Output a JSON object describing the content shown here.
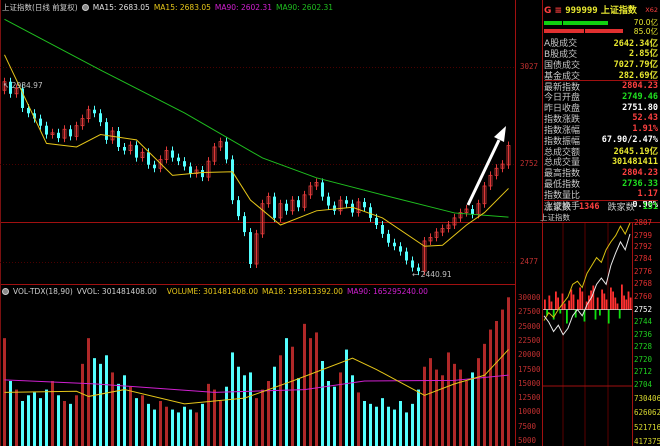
{
  "header": {
    "title": "上证指数(日线 前复权)",
    "ma15_a": "MA15: 2683.05",
    "ma15_b": "MA15: 2683.05",
    "ma90_a": "MA90: 2602.31",
    "ma90_b": "MA90: 2602.31"
  },
  "vol_header": {
    "name": "VOL-TDX(18,90)",
    "vvol": "VVOL: 301481408.00",
    "volume": "VOLUME: 301481408.00",
    "ma18": "MA18: 195813392.00",
    "ma90": "MA90: 165295240.00"
  },
  "colors": {
    "up": "#e03a3a",
    "down": "#54ffff",
    "ma15": "#e6c619",
    "ma90": "#1fbf1f",
    "vol_ma90": "#d020d0",
    "grid": "#6b0000",
    "text_up": "#ff4040",
    "text_down": "#20e020",
    "text_yellow": "#e8e830"
  },
  "annotations": {
    "high_label": "2984.97",
    "low_label": "2440.91"
  },
  "price_axis": [
    "3027",
    "2752",
    "2477"
  ],
  "volume_axis": [
    "30000",
    "27500",
    "25000",
    "22500",
    "20000",
    "17500",
    "15000",
    "12500",
    "10000",
    "7500",
    "5000"
  ],
  "chart_data": [
    {
      "type": "candlestick",
      "title": "上证指数(日线 前复权)",
      "yticks": [
        3027,
        2752,
        2477
      ],
      "close": [
        2984,
        2950,
        2965,
        2910,
        2895,
        2880,
        2860,
        2835,
        2840,
        2825,
        2850,
        2830,
        2860,
        2880,
        2905,
        2895,
        2870,
        2820,
        2845,
        2800,
        2790,
        2805,
        2770,
        2785,
        2750,
        2740,
        2765,
        2790,
        2770,
        2760,
        2745,
        2725,
        2735,
        2715,
        2760,
        2800,
        2815,
        2765,
        2650,
        2605,
        2560,
        2470,
        2555,
        2640,
        2660,
        2600,
        2640,
        2620,
        2650,
        2630,
        2665,
        2690,
        2700,
        2660,
        2635,
        2620,
        2650,
        2640,
        2615,
        2645,
        2630,
        2600,
        2580,
        2555,
        2530,
        2520,
        2505,
        2480,
        2460,
        2450,
        2535,
        2545,
        2560,
        2570,
        2580,
        2600,
        2615,
        2625,
        2610,
        2640,
        2690,
        2720,
        2740,
        2751.8,
        2804.23
      ],
      "open": [
        2960,
        2984,
        2950,
        2965,
        2910,
        2895,
        2880,
        2860,
        2835,
        2840,
        2825,
        2850,
        2830,
        2860,
        2880,
        2905,
        2895,
        2870,
        2820,
        2845,
        2800,
        2790,
        2805,
        2770,
        2785,
        2750,
        2740,
        2765,
        2790,
        2770,
        2760,
        2745,
        2725,
        2735,
        2715,
        2760,
        2800,
        2815,
        2765,
        2650,
        2605,
        2560,
        2470,
        2555,
        2640,
        2660,
        2600,
        2640,
        2620,
        2650,
        2630,
        2665,
        2690,
        2700,
        2660,
        2635,
        2620,
        2650,
        2640,
        2615,
        2645,
        2630,
        2600,
        2580,
        2555,
        2530,
        2520,
        2505,
        2480,
        2460,
        2450,
        2535,
        2545,
        2560,
        2570,
        2580,
        2600,
        2615,
        2625,
        2610,
        2640,
        2690,
        2720,
        2740,
        2749.46
      ],
      "ma15": [
        [
          0,
          3060
        ],
        [
          7,
          2810
        ],
        [
          12,
          2800
        ],
        [
          16,
          2835
        ],
        [
          22,
          2820
        ],
        [
          28,
          2720
        ],
        [
          33,
          2728
        ],
        [
          38,
          2730
        ],
        [
          41,
          2650
        ],
        [
          46,
          2580
        ],
        [
          52,
          2620
        ],
        [
          58,
          2630
        ],
        [
          63,
          2600
        ],
        [
          70,
          2520
        ],
        [
          73,
          2523
        ],
        [
          77,
          2580
        ],
        [
          80,
          2615
        ],
        [
          84,
          2683.05
        ]
      ],
      "ma90": [
        [
          0,
          3160
        ],
        [
          16,
          3017
        ],
        [
          30,
          2896
        ],
        [
          43,
          2769
        ],
        [
          52,
          2713
        ],
        [
          63,
          2665
        ],
        [
          75,
          2614
        ],
        [
          84,
          2602.31
        ]
      ]
    },
    {
      "type": "bar",
      "title": "VOL-TDX(18,90)",
      "yticks": [
        30000,
        27500,
        25000,
        22500,
        20000,
        17500,
        15000,
        12500,
        10000,
        7500,
        5000
      ],
      "volume": [
        23000,
        15500,
        14000,
        12000,
        13000,
        13500,
        12500,
        14000,
        15500,
        13000,
        12000,
        11500,
        13000,
        18500,
        23000,
        19500,
        18500,
        20000,
        17000,
        15000,
        16500,
        14500,
        12500,
        13000,
        11500,
        10500,
        12000,
        11000,
        10500,
        10000,
        11000,
        10500,
        10000,
        11500,
        15000,
        14000,
        12000,
        14500,
        20500,
        18000,
        16500,
        17000,
        12500,
        14000,
        15500,
        18000,
        20000,
        23000,
        21500,
        16000,
        25500,
        23000,
        24000,
        19000,
        15500,
        14500,
        17000,
        21000,
        16500,
        13500,
        12000,
        11500,
        11000,
        12500,
        11000,
        10500,
        12000,
        10000,
        11500,
        14000,
        18000,
        19500,
        17500,
        16500,
        20500,
        18500,
        17500,
        15500,
        17000,
        19500,
        22000,
        24500,
        26000,
        28000,
        30148
      ],
      "ma18": [
        [
          0,
          13500
        ],
        [
          12,
          13700
        ],
        [
          14,
          12800
        ],
        [
          20,
          14000
        ],
        [
          30,
          11500
        ],
        [
          40,
          12500
        ],
        [
          48,
          15500
        ],
        [
          58,
          19500
        ],
        [
          62,
          17500
        ],
        [
          70,
          13000
        ],
        [
          75,
          15000
        ],
        [
          80,
          16500
        ],
        [
          84,
          21000
        ]
      ],
      "ma90": [
        [
          0,
          15700
        ],
        [
          15,
          15000
        ],
        [
          35,
          13500
        ],
        [
          50,
          14000
        ],
        [
          60,
          15500
        ],
        [
          75,
          15600
        ],
        [
          84,
          16529.5
        ]
      ]
    },
    {
      "type": "line",
      "title": "上证指数",
      "yticks": [
        2807,
        2799,
        2792,
        2784,
        2776,
        2768,
        2760,
        2752,
        2744,
        2736,
        2728,
        2720,
        2712,
        2704
      ],
      "volume_ticks": [
        "730406",
        "626062",
        "521716",
        "417375"
      ],
      "yellow": [
        2745,
        2750,
        2747,
        2752,
        2756,
        2760,
        2768,
        2770,
        2766,
        2775,
        2780,
        2785,
        2782,
        2790,
        2795,
        2799,
        2805,
        2800,
        2807
      ],
      "white": [
        2748,
        2744,
        2738,
        2742,
        2736,
        2740,
        2748,
        2752,
        2748,
        2755,
        2760,
        2768,
        2772,
        2768,
        2780,
        2788,
        2795,
        2790,
        2800
      ],
      "breadth": [
        10,
        -6,
        14,
        8,
        -10,
        18,
        12,
        -4,
        16,
        6,
        -14,
        9,
        20,
        15,
        -8,
        10,
        22,
        18,
        -12,
        8,
        14,
        19,
        24,
        -10,
        12,
        -6,
        20,
        16,
        10,
        -14,
        22,
        18,
        12,
        6,
        -9,
        25,
        14,
        10,
        18,
        12
      ]
    }
  ],
  "panel": {
    "code_prefix": "G ≡",
    "code": "999999",
    "name": "上证指数",
    "tag": "X62",
    "bar1_label": "70.0亿",
    "bar2_label": "85.0亿",
    "rows": [
      {
        "label": "A股成交",
        "value": "2642.34亿",
        "color": "#e8e830"
      },
      {
        "label": "B股成交",
        "value": "2.85亿",
        "color": "#e8e830"
      },
      {
        "label": "国债成交",
        "value": "7027.79亿",
        "color": "#e8e830"
      },
      {
        "label": "基金成交",
        "value": "282.69亿",
        "color": "#e8e830"
      },
      {
        "label": "最新指数",
        "value": "2804.23",
        "color": "#ff4040"
      },
      {
        "label": "今日开盘",
        "value": "2749.46",
        "color": "#20e020"
      },
      {
        "label": "昨日收盘",
        "value": "2751.80",
        "color": "#ffffff"
      },
      {
        "label": "指数涨跌",
        "value": "52.43",
        "color": "#ff4040"
      },
      {
        "label": "指数涨幅",
        "value": "1.91%",
        "color": "#ff4040"
      },
      {
        "label": "指数振幅",
        "value": "67.90/2.47%",
        "color": "#ffffff"
      },
      {
        "label": "总成交额",
        "value": "2645.19亿",
        "color": "#e8e830"
      },
      {
        "label": "总成交量",
        "value": "301481411",
        "color": "#e8e830"
      },
      {
        "label": "最高指数",
        "value": "2804.23",
        "color": "#ff4040"
      },
      {
        "label": "最低指数",
        "value": "2736.33",
        "color": "#20e020"
      },
      {
        "label": "指数量比",
        "value": "1.17",
        "color": "#ff4040"
      },
      {
        "label": "上证换手",
        "value": "0.90%",
        "color": "#ffffff"
      }
    ],
    "up_label": "涨家数",
    "up_count": "1346",
    "down_label": "跌家数",
    "down_count": "131",
    "mini_title": "上证指数"
  }
}
